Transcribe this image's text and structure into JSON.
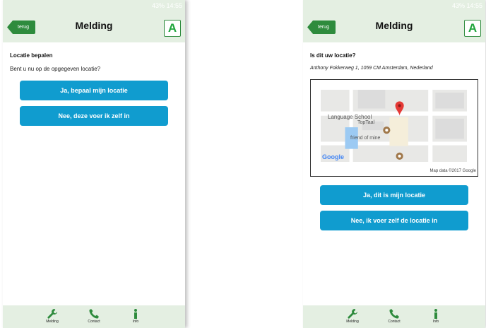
{
  "status": {
    "text": "43% 14:55"
  },
  "left": {
    "back_label": "terug",
    "title": "Melding",
    "logo_letter": "A",
    "section_title": "Locatie bepalen",
    "question": "Bent u nu op de opgegeven locatie?",
    "btn_yes": "Ja, bepaal mijn locatie",
    "btn_no": "Nee, deze voer ik zelf in"
  },
  "right": {
    "back_label": "terug",
    "title": "Melding",
    "logo_letter": "A",
    "section_title": "Is dit uw locatie?",
    "address": "Anthony Fokkerweg 1, 1059 CM Amsterdam, Nederland",
    "map": {
      "place1": "Language School",
      "place1_sub": "TopTaal",
      "place2": "friend of mine",
      "brand": "Google",
      "attribution": "Map data ©2017 Google"
    },
    "btn_yes": "Ja, dit is mijn locatie",
    "btn_no": "Nee, ik voer zelf de locatie in"
  },
  "tabs": [
    {
      "label": "Melding",
      "icon": "wrench-icon"
    },
    {
      "label": "Contact",
      "icon": "phone-icon"
    },
    {
      "label": "Info",
      "icon": "info-icon"
    }
  ],
  "colors": {
    "accent": "#109ccf",
    "header": "#e4efe2",
    "brand_green": "#2e8b3d"
  }
}
